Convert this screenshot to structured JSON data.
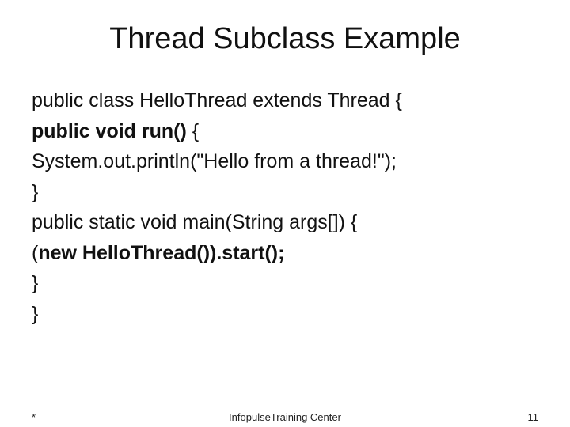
{
  "title": "Thread Subclass Example",
  "code": {
    "line1": "public class HelloThread extends Thread {",
    "line2a": "public void run()",
    "line2b": " {",
    "line3": "System.out.println(\"Hello from a thread!\");",
    "line4": "}",
    "line5": "public static void main(String args[]) {",
    "line6a": " (",
    "line6b": "new HelloThread()).start();",
    "line7": "}",
    "line8": "}"
  },
  "footer": {
    "left": "*",
    "center": "InfopulseTraining Center",
    "page": "11"
  }
}
